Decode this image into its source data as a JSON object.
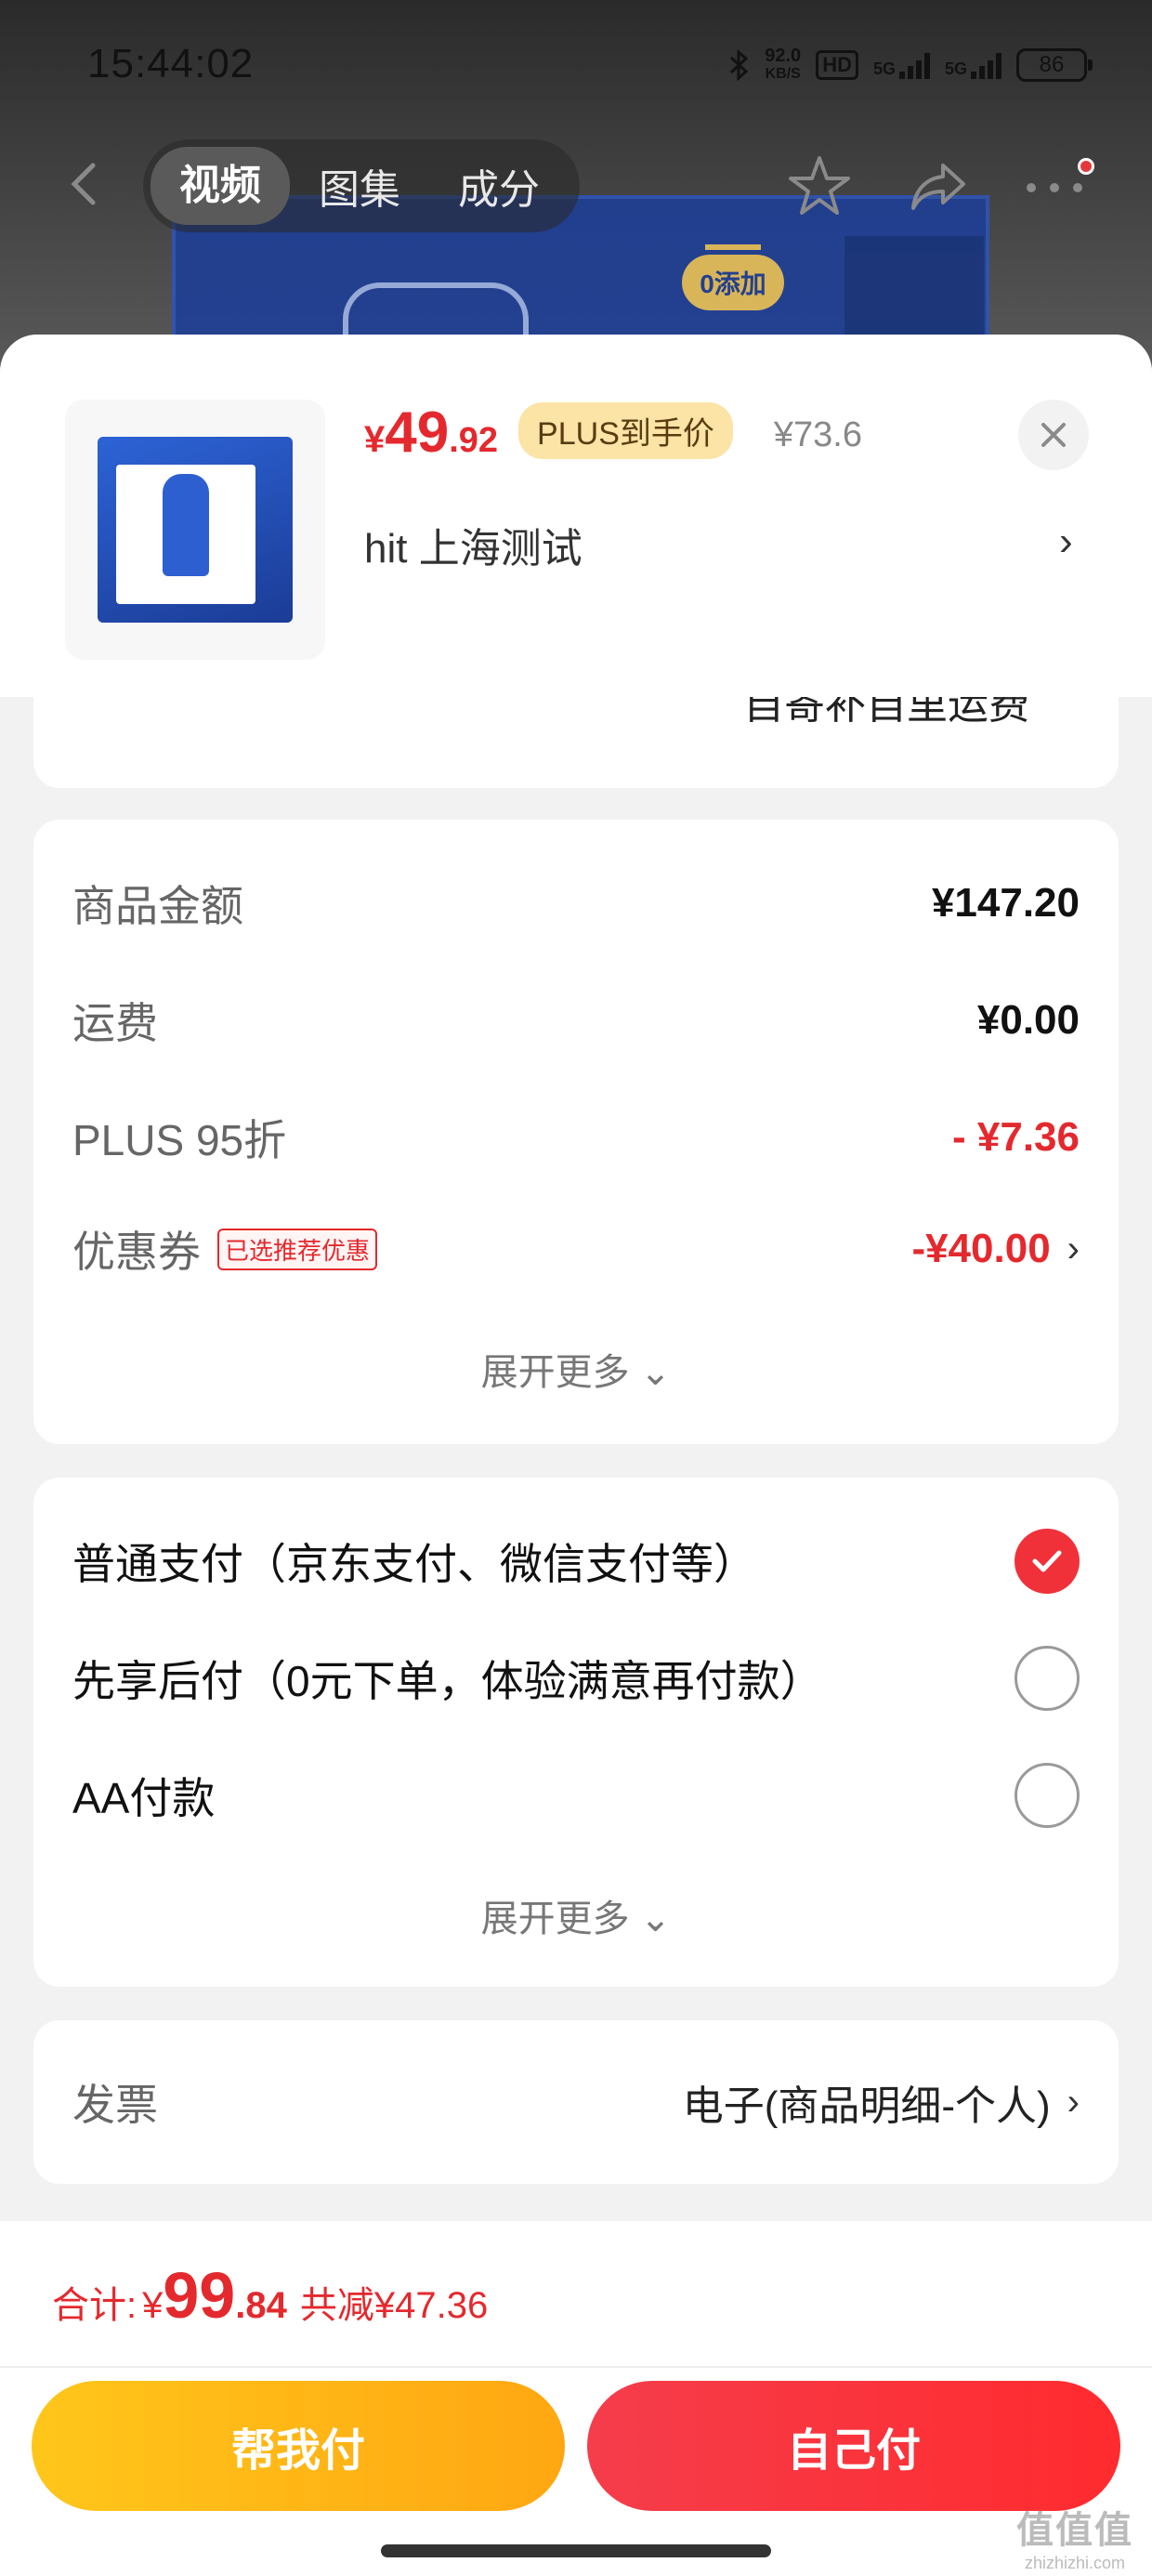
{
  "status": {
    "time": "15:44:02",
    "net_speed_value": "92.0",
    "net_speed_unit": "KB/S",
    "hd": "HD",
    "signal1": "5G",
    "signal2": "5G",
    "battery": "86"
  },
  "nav": {
    "tabs": [
      "视频",
      "图集",
      "成分"
    ],
    "active_tab": "视频"
  },
  "background_product": {
    "badge": "0添加"
  },
  "product": {
    "currency": "¥",
    "price_int": "49",
    "price_dec": ".92",
    "plus_tag": "PLUS到手价",
    "orig_price": "¥73.6",
    "address": "hit  上海测试",
    "chevron": "›"
  },
  "partial_card": {
    "text": "自寄补自里运费"
  },
  "summary": {
    "rows": [
      {
        "label": "商品金额",
        "value": "¥147.20"
      },
      {
        "label": "运费",
        "value": "¥0.00"
      },
      {
        "label": "PLUS 95折",
        "value": "- ¥7.36"
      },
      {
        "label": "优惠券",
        "tag": "已选推荐优惠",
        "value": "-¥40.00",
        "chevron": "›"
      }
    ],
    "expand": "展开更多 ⌄"
  },
  "payment": {
    "options": [
      {
        "label": "普通支付（京东支付、微信支付等）",
        "checked": true
      },
      {
        "label": "先享后付（0元下单，体验满意再付款）",
        "checked": false
      },
      {
        "label": "AA付款",
        "checked": false
      }
    ],
    "expand": "展开更多 ⌄"
  },
  "invoice": {
    "label": "发票",
    "value": "电子(商品明细-个人)",
    "chevron": "›"
  },
  "bottom": {
    "total_label": "合计:",
    "currency": "¥",
    "total_int": "99",
    "total_dec": ".84",
    "saved": "共减¥47.36",
    "btn_help": "帮我付",
    "btn_self": "自己付"
  },
  "watermark": {
    "big": "值值值",
    "small": "zhizhizhi.com"
  },
  "colors": {
    "accent": "#e4292e",
    "plus_tag_bg": "#fbe4a6",
    "btn_yellow": "#ffb515",
    "btn_red": "#f5343d"
  }
}
